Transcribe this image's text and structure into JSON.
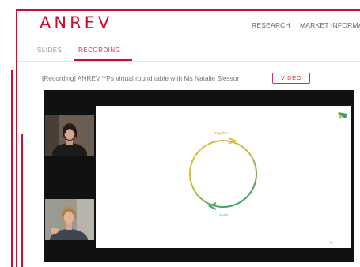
{
  "header": {
    "logo_text": "ANREV",
    "nav": [
      "RESEARCH",
      "MARKET INFORMA"
    ]
  },
  "tabs": [
    {
      "label": "SLIDES"
    },
    {
      "label": "RECORDING",
      "active": true
    }
  ],
  "recording": {
    "title": "[Recording] ANREV YPs virtual round table with Ms Natalie Slessor",
    "badge": "VIDEO"
  },
  "slide": {
    "top_label": "Together",
    "bottom_label": "Apart"
  },
  "colors": {
    "brand_red": "#c8102e",
    "tab_active": "#d0344a",
    "cycle_yellow": "#e9b93c",
    "cycle_green": "#3aa55a",
    "player_bg": "#111111"
  }
}
